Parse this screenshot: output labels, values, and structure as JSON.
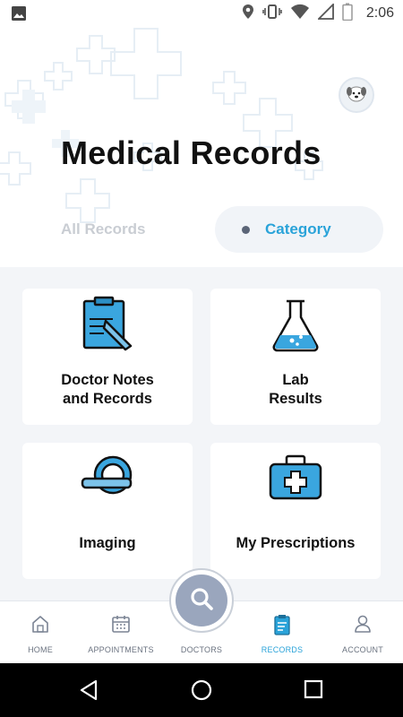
{
  "status_bar": {
    "time": "2:06",
    "icons": [
      "image-icon",
      "location-icon",
      "vibrate-icon",
      "wifi-icon",
      "signal-icon",
      "battery-icon"
    ]
  },
  "header": {
    "title": "Medical Records",
    "avatar_icon": "dog-avatar-icon"
  },
  "segments": {
    "all_label": "All Records",
    "category_label": "Category",
    "selected": "Category"
  },
  "cards": [
    {
      "label": "Doctor Notes\nand Records",
      "icon": "clipboard-icon"
    },
    {
      "label": "Lab\nResults",
      "icon": "flask-icon"
    },
    {
      "label": "Imaging",
      "icon": "scanner-icon"
    },
    {
      "label": "My Prescriptions",
      "icon": "first-aid-kit-icon"
    }
  ],
  "bottom_nav": {
    "items": [
      {
        "label": "HOME",
        "icon": "home-icon"
      },
      {
        "label": "APPOINTMENTS",
        "icon": "calendar-icon"
      },
      {
        "label": "DOCTORS",
        "icon": "search-icon"
      },
      {
        "label": "RECORDS",
        "icon": "records-icon"
      },
      {
        "label": "ACCOUNT",
        "icon": "person-icon"
      }
    ],
    "active": "RECORDS"
  },
  "colors": {
    "accent": "#2aa3d9",
    "title": "#111111",
    "inactive_segment": "#c9cdd3",
    "content_bg": "#f3f5f8",
    "fab": "#9aa6bd"
  }
}
